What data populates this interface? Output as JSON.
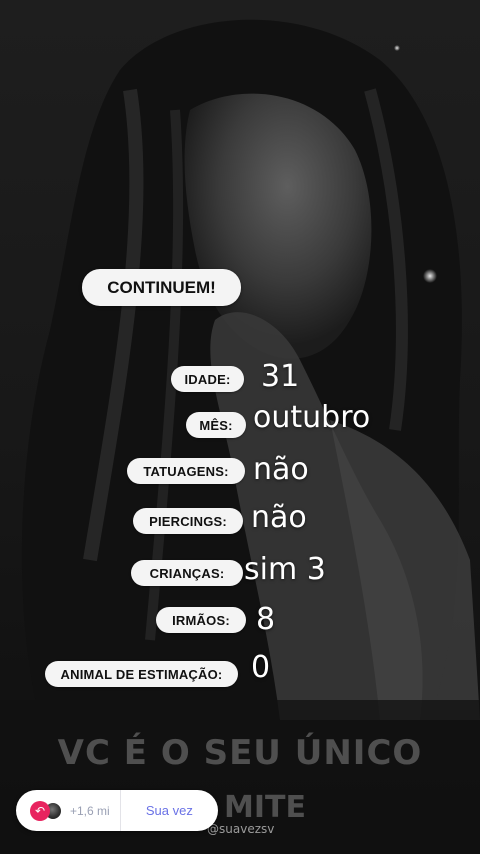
{
  "story": {
    "cta_label": "CONTINUEM!",
    "fields": [
      {
        "label": "IDADE:",
        "answer": "31"
      },
      {
        "label": "MÊS:",
        "answer": "outubro"
      },
      {
        "label": "TATUAGENS:",
        "answer": "não"
      },
      {
        "label": "PIERCINGS:",
        "answer": "não"
      },
      {
        "label": "CRIANÇAS:",
        "answer": "sim 3"
      },
      {
        "label": "IRMÃOS:",
        "answer": "8"
      },
      {
        "label": "ANIMAL DE ESTIMAÇÃO:",
        "answer": "0"
      }
    ],
    "watermark_line1": "VC É O SEU ÚNICO",
    "watermark_line2": "MITE",
    "watermark_handle": "@suavezsv"
  },
  "reply_bar": {
    "reply_icon": "reply-arrow-icon",
    "avatar": "avatar",
    "count": "+1,6 mi",
    "action_label": "Sua vez"
  },
  "colors": {
    "pill_bg": "#f4f4f4",
    "accent_pink": "#e8235f",
    "action_blue": "#6a72e6"
  }
}
